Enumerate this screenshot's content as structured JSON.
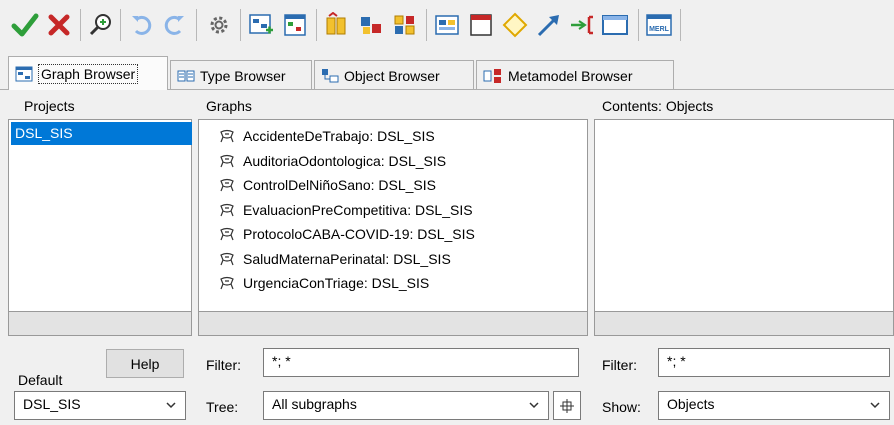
{
  "toolbar": {
    "buttons": [
      {
        "name": "ok-check-icon"
      },
      {
        "name": "cancel-x-icon"
      },
      {
        "name": "zoom-icon"
      },
      {
        "name": "undo-icon"
      },
      {
        "name": "redo-icon"
      },
      {
        "name": "settings-gear-icon"
      },
      {
        "name": "graph-add-icon"
      },
      {
        "name": "graph-browse-icon"
      },
      {
        "name": "object-library-icon"
      },
      {
        "name": "object-tree-icon"
      },
      {
        "name": "object-multi-icon"
      },
      {
        "name": "property-icon"
      },
      {
        "name": "window-icon"
      },
      {
        "name": "diamond-port-icon"
      },
      {
        "name": "arrow-relationship-icon"
      },
      {
        "name": "role-icon"
      },
      {
        "name": "window-frame-icon"
      },
      {
        "name": "merl-icon",
        "label": "MERL"
      }
    ]
  },
  "tabs": [
    {
      "label": "Graph Browser",
      "active": true
    },
    {
      "label": "Type Browser",
      "active": false
    },
    {
      "label": "Object Browser",
      "active": false
    },
    {
      "label": "Metamodel Browser",
      "active": false
    }
  ],
  "projects": {
    "header": "Projects",
    "items": [
      "DSL_SIS"
    ],
    "help_label": "Help",
    "default_label": "Default",
    "default_value": "DSL_SIS"
  },
  "graphs": {
    "header": "Graphs",
    "items": [
      "AccidenteDeTrabajo: DSL_SIS",
      "AuditoriaOdontologica: DSL_SIS",
      "ControlDelNiñoSano: DSL_SIS",
      "EvaluacionPreCompetitiva: DSL_SIS",
      "ProtocoloCABA-COVID-19: DSL_SIS",
      "SaludMaternaPerinatal: DSL_SIS",
      "UrgenciaConTriage: DSL_SIS"
    ],
    "filter_label": "Filter:",
    "filter_value": "*; *",
    "tree_label": "Tree:",
    "tree_value": "All subgraphs"
  },
  "contents": {
    "header": "Contents: Objects",
    "filter_label": "Filter:",
    "filter_value": "*; *",
    "show_label": "Show:",
    "show_value": "Objects"
  },
  "colors": {
    "selection": "#0078d7",
    "check": "#2e9e3a",
    "cross": "#c62828"
  }
}
